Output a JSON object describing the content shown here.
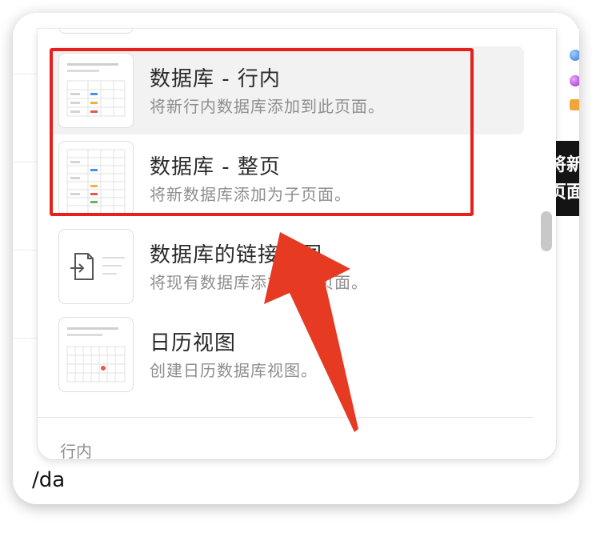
{
  "menu": {
    "items": [
      {
        "title": "数据库 - 行内",
        "description": "将新行内数据库添加到此页面。",
        "icon": "inline-database-icon"
      },
      {
        "title": "数据库 - 整页",
        "description": "将新数据库添加为子页面。",
        "icon": "fullpage-database-icon"
      },
      {
        "title": "数据库的链接视图",
        "description": "将现有数据库添加到此页面。",
        "icon": "linked-view-icon"
      },
      {
        "title": "日历视图",
        "description": "创建日历数据库视图。",
        "icon": "calendar-view-icon"
      }
    ],
    "section_label": "行内"
  },
  "editor": {
    "command_text": "/da"
  },
  "side_preview": {
    "tip_line1": "将新",
    "tip_line2": "页面"
  },
  "annotation": {
    "box_color": "#e8201c",
    "arrow_color": "#e63a22"
  }
}
